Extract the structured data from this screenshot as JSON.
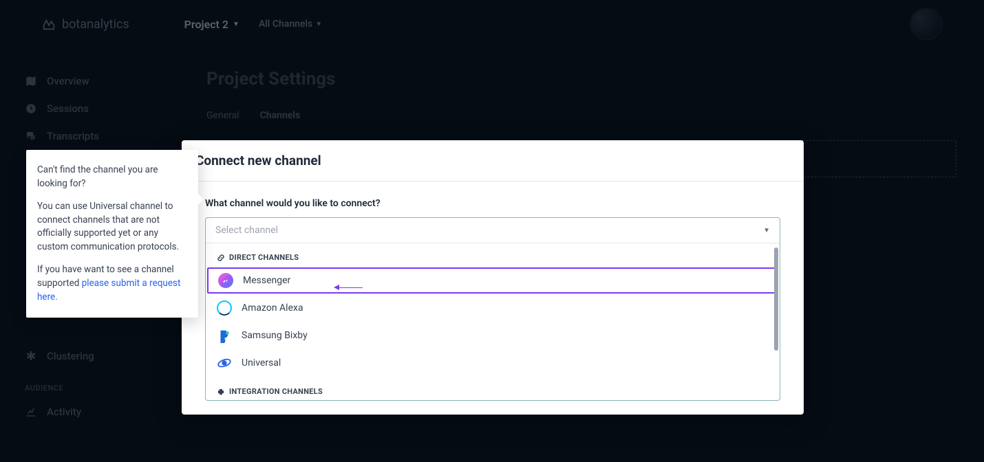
{
  "header": {
    "brand": "botanalytics",
    "project": "Project 2",
    "channel_filter": "All Channels"
  },
  "sidebar": {
    "items": [
      {
        "label": "Overview",
        "icon": "map"
      },
      {
        "label": "Sessions",
        "icon": "clock"
      },
      {
        "label": "Transcripts",
        "icon": "chat"
      },
      {
        "label": "Clustering",
        "icon": "asterisk"
      }
    ],
    "section_label": "AUDIENCE",
    "audience_items": [
      {
        "label": "Activity",
        "icon": "chart"
      }
    ]
  },
  "page": {
    "title": "Project Settings",
    "tabs": {
      "general": "General",
      "channels": "Channels"
    }
  },
  "modal": {
    "title": "Connect new channel",
    "question": "What channel would you like to connect?",
    "placeholder": "Select channel",
    "group_direct": "DIRECT CHANNELS",
    "group_integration": "INTEGRATION CHANNELS",
    "options": [
      {
        "label": "Messenger",
        "highlight": true
      },
      {
        "label": "Amazon Alexa"
      },
      {
        "label": "Samsung Bixby"
      },
      {
        "label": "Universal"
      }
    ]
  },
  "tooltip": {
    "p1": "Can't find the channel you are looking for?",
    "p2": "You can use Universal channel to connect channels that are not officially supported yet or any custom communication protocols.",
    "p3_a": "If you have want to see a channel supported ",
    "p3_link": "please submit a request here.",
    "p3_b": ""
  }
}
